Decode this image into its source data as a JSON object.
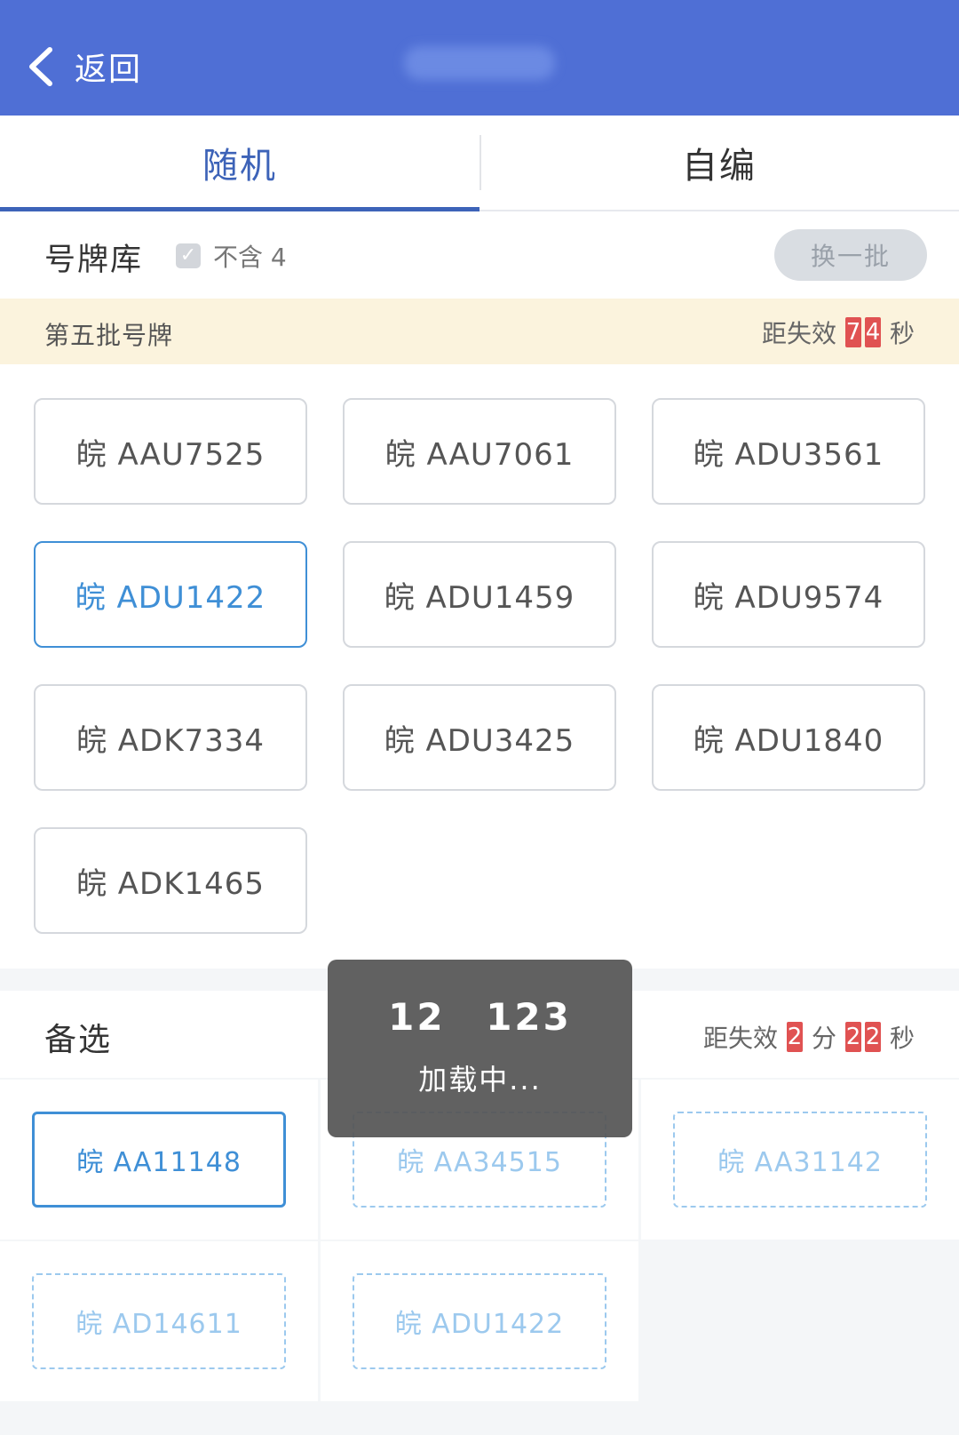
{
  "header": {
    "back_label": "返回"
  },
  "tabs": [
    {
      "label": "随机",
      "active": true
    },
    {
      "label": "自编",
      "active": false
    }
  ],
  "library": {
    "label": "号牌库",
    "exclude_label": "不含 4",
    "exclude_checked": true,
    "refresh_label": "换一批"
  },
  "batch": {
    "name": "第五批号牌",
    "expire_prefix": "距失效",
    "seconds_digits": [
      "7",
      "4"
    ],
    "seconds_unit": "秒"
  },
  "plates": [
    {
      "text": "皖 AAU7525",
      "selected": false
    },
    {
      "text": "皖 AAU7061",
      "selected": false
    },
    {
      "text": "皖 ADU3561",
      "selected": false
    },
    {
      "text": "皖 ADU1422",
      "selected": true
    },
    {
      "text": "皖 ADU1459",
      "selected": false
    },
    {
      "text": "皖 ADU9574",
      "selected": false
    },
    {
      "text": "皖 ADK7334",
      "selected": false
    },
    {
      "text": "皖 ADU3425",
      "selected": false
    },
    {
      "text": "皖 ADU1840",
      "selected": false
    },
    {
      "text": "皖 ADK1465",
      "selected": false
    }
  ],
  "alternates": {
    "label": "备选",
    "expire_prefix": "距失效",
    "minutes_digits": [
      "2"
    ],
    "minutes_unit": "分",
    "seconds_digits": [
      "2",
      "2"
    ],
    "seconds_unit": "秒",
    "items": [
      {
        "text": "皖 AA11148",
        "style": "solid"
      },
      {
        "text": "皖 AA34515",
        "style": "dashed"
      },
      {
        "text": "皖 AA31142",
        "style": "dashed"
      },
      {
        "text": "皖 AD14611",
        "style": "dashed"
      },
      {
        "text": "皖 ADU1422",
        "style": "dashed"
      }
    ]
  },
  "toast": {
    "numbers": "12 123",
    "message": "加载中..."
  },
  "colors": {
    "header_bg": "#4f6fd5",
    "accent": "#3f8fd6",
    "tab_active": "#3d63b8",
    "countdown_digit_bg": "#e05252",
    "banner_bg": "#fbf3dd"
  }
}
